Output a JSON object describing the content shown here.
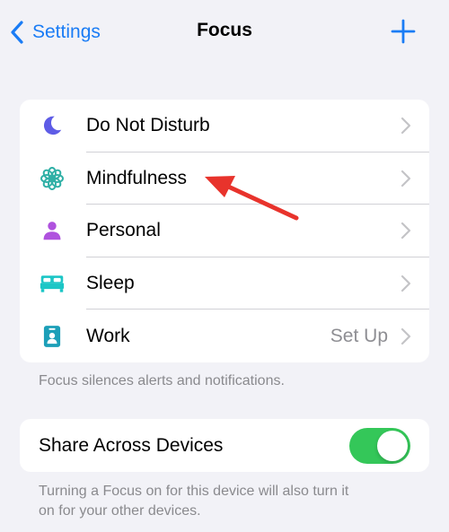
{
  "navbar": {
    "back_label": "Settings",
    "title": "Focus"
  },
  "focus_items": [
    {
      "label": "Do Not Disturb",
      "icon": "moon-icon",
      "color": "#5e5ce6",
      "detail": ""
    },
    {
      "label": "Mindfulness",
      "icon": "flower-icon",
      "color": "#30b0a6",
      "detail": ""
    },
    {
      "label": "Personal",
      "icon": "person-icon",
      "color": "#af52de",
      "detail": ""
    },
    {
      "label": "Sleep",
      "icon": "bed-icon",
      "color": "#1cc6c6",
      "detail": ""
    },
    {
      "label": "Work",
      "icon": "badge-icon",
      "color": "#1c9fb8",
      "detail": "Set Up"
    }
  ],
  "focus_footnote": "Focus silences alerts and notifications.",
  "share": {
    "label": "Share Across Devices",
    "enabled": true
  },
  "share_footnote_line1": "Turning a Focus on for this device will also turn it",
  "share_footnote_line2": "on for your other devices.",
  "colors": {
    "accent": "#1a7cf5",
    "toggle_on": "#34c759",
    "annotation_arrow": "#e8332c"
  }
}
